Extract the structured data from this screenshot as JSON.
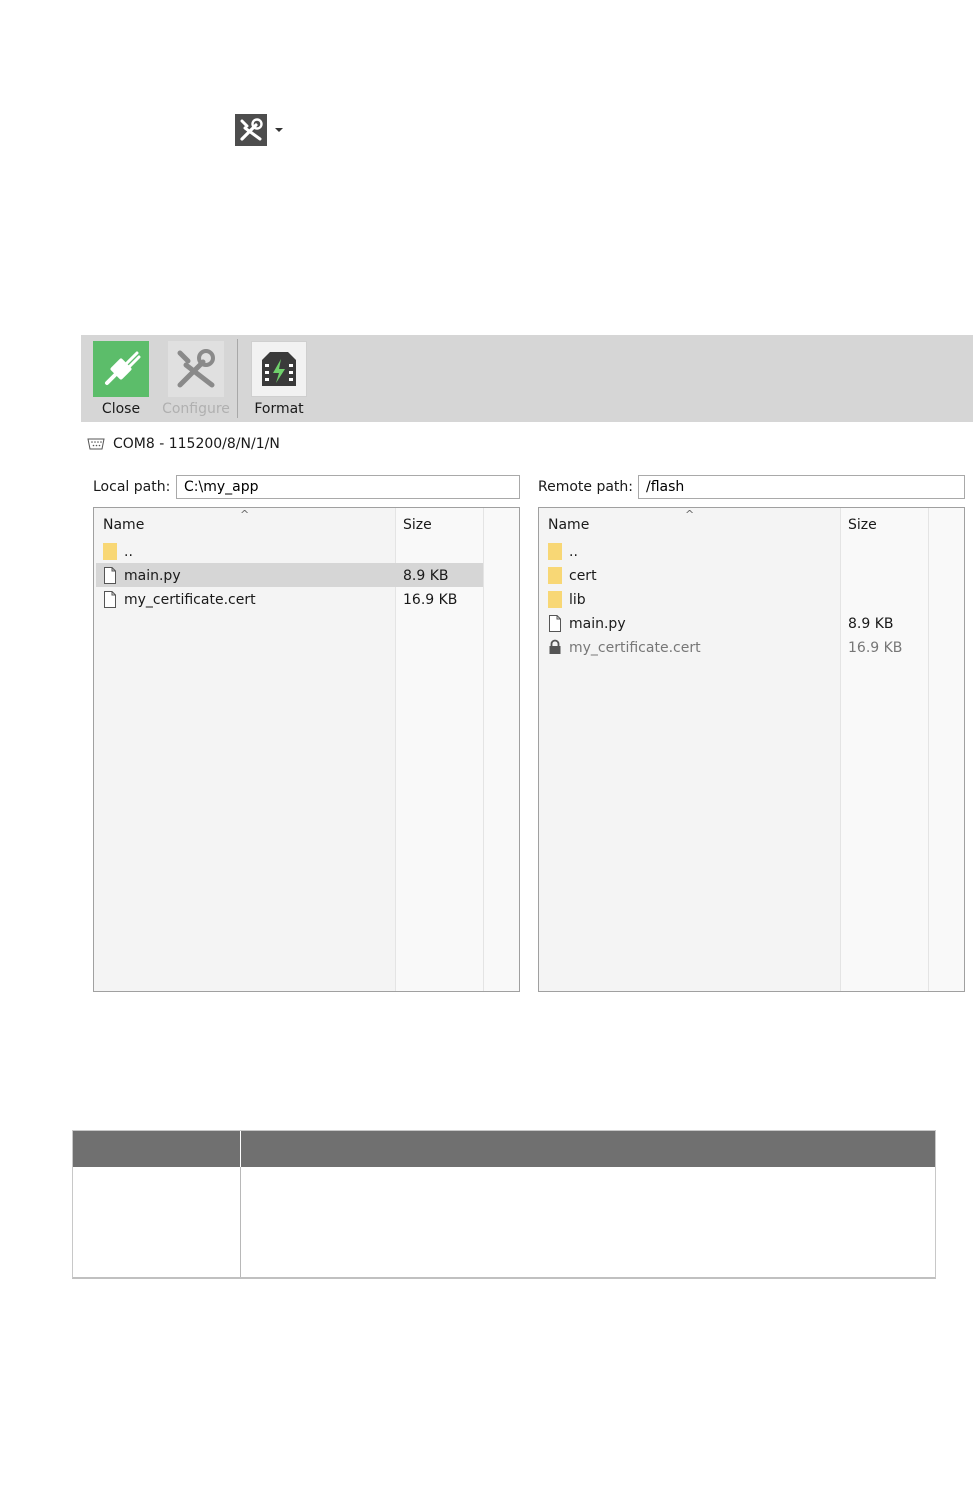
{
  "top_dropdown": {
    "icon": "configure-icon",
    "caret": "caret-down-icon"
  },
  "toolbar": {
    "close_label": "Close",
    "configure_label": "Configure",
    "format_label": "Format",
    "colors": {
      "close_bg": "#5cbd6a",
      "configure_disabled": "#b0b0b0"
    }
  },
  "connection": {
    "text": "COM8 - 115200/8/N/1/N",
    "icon": "serial-port-icon"
  },
  "local": {
    "path_label": "Local path:",
    "path_value": "C:\\my_app",
    "columns": {
      "name": "Name",
      "size": "Size"
    },
    "rows": [
      {
        "name": "..",
        "size": "",
        "type": "folder"
      },
      {
        "name": "main.py",
        "size": "8.9 KB",
        "type": "file",
        "selected": true
      },
      {
        "name": "my_certificate.cert",
        "size": "16.9 KB",
        "type": "file"
      }
    ]
  },
  "remote": {
    "path_label": "Remote path:",
    "path_value": "/flash",
    "columns": {
      "name": "Name",
      "size": "Size"
    },
    "rows": [
      {
        "name": "..",
        "size": "",
        "type": "folder"
      },
      {
        "name": "cert",
        "size": "",
        "type": "folder"
      },
      {
        "name": "lib",
        "size": "",
        "type": "folder"
      },
      {
        "name": "main.py",
        "size": "8.9 KB",
        "type": "file"
      },
      {
        "name": "my_certificate.cert",
        "size": "16.9 KB",
        "type": "locked"
      }
    ]
  },
  "table": {
    "header_color": "#707070"
  }
}
